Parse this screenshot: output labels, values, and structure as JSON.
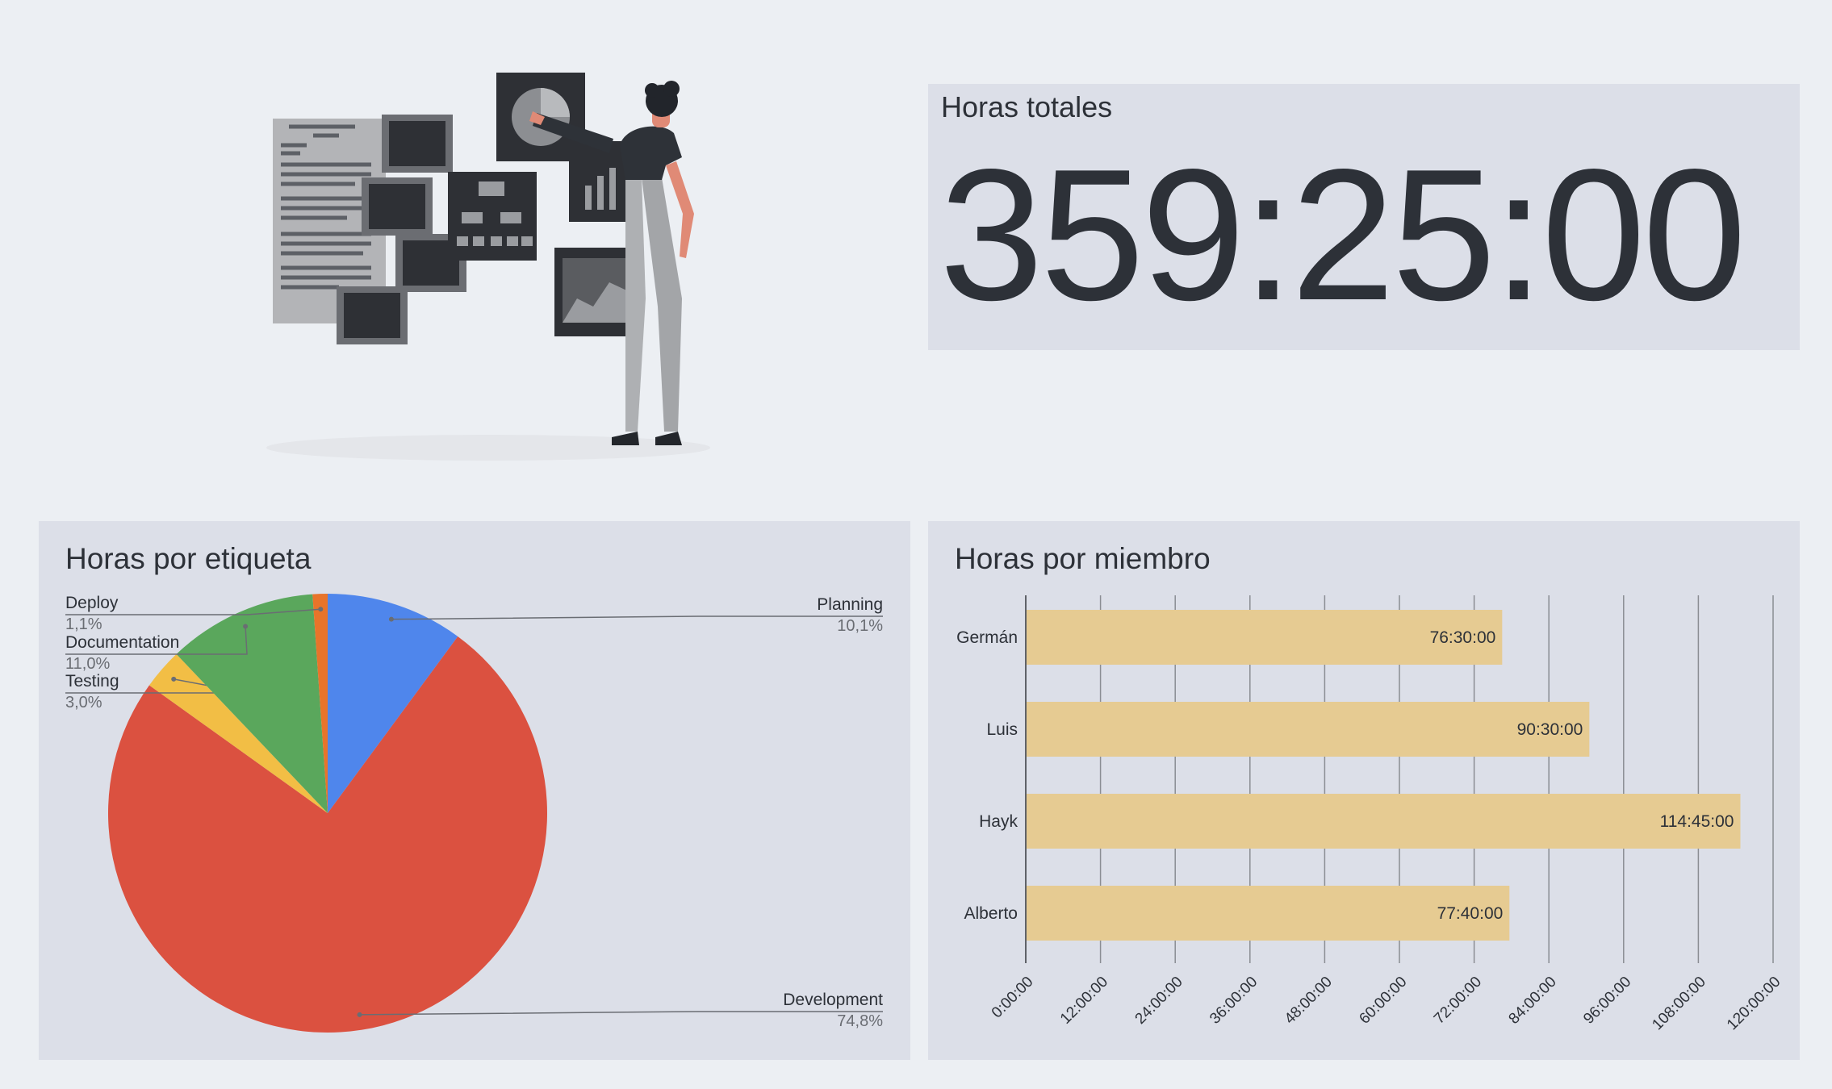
{
  "total": {
    "title": "Horas totales",
    "value": "359:25:00"
  },
  "pie": {
    "title": "Horas por etiqueta",
    "colors": {
      "Planning": "#4f86ec",
      "Development": "#db5140",
      "Testing": "#f2be45",
      "Documentation": "#5aa75c",
      "Deploy": "#e8742a"
    }
  },
  "bar": {
    "title": "Horas por miembro",
    "bar_color": "#e6cb92"
  },
  "illustration": {
    "icon": "person-with-dashboard-illustration"
  },
  "chart_data": [
    {
      "type": "pie",
      "title": "Horas por etiqueta",
      "slices": [
        {
          "label": "Planning",
          "value": 10.1,
          "pct_label": "10,1%"
        },
        {
          "label": "Development",
          "value": 74.8,
          "pct_label": "74,8%"
        },
        {
          "label": "Testing",
          "value": 3.0,
          "pct_label": "3,0%"
        },
        {
          "label": "Documentation",
          "value": 11.0,
          "pct_label": "11,0%"
        },
        {
          "label": "Deploy",
          "value": 1.1,
          "pct_label": "1,1%"
        }
      ]
    },
    {
      "type": "bar",
      "orientation": "horizontal",
      "title": "Horas por miembro",
      "categories": [
        "Germán",
        "Luis",
        "Hayk",
        "Alberto"
      ],
      "values": [
        76.5,
        90.5,
        114.75,
        77.6667
      ],
      "value_labels": [
        "76:30:00",
        "90:30:00",
        "114:45:00",
        "77:40:00"
      ],
      "xlim": [
        0,
        120
      ],
      "xticks": [
        "0:00:00",
        "12:00:00",
        "24:00:00",
        "36:00:00",
        "48:00:00",
        "60:00:00",
        "72:00:00",
        "84:00:00",
        "96:00:00",
        "108:00:00",
        "120:00:00"
      ],
      "grid": true
    }
  ]
}
